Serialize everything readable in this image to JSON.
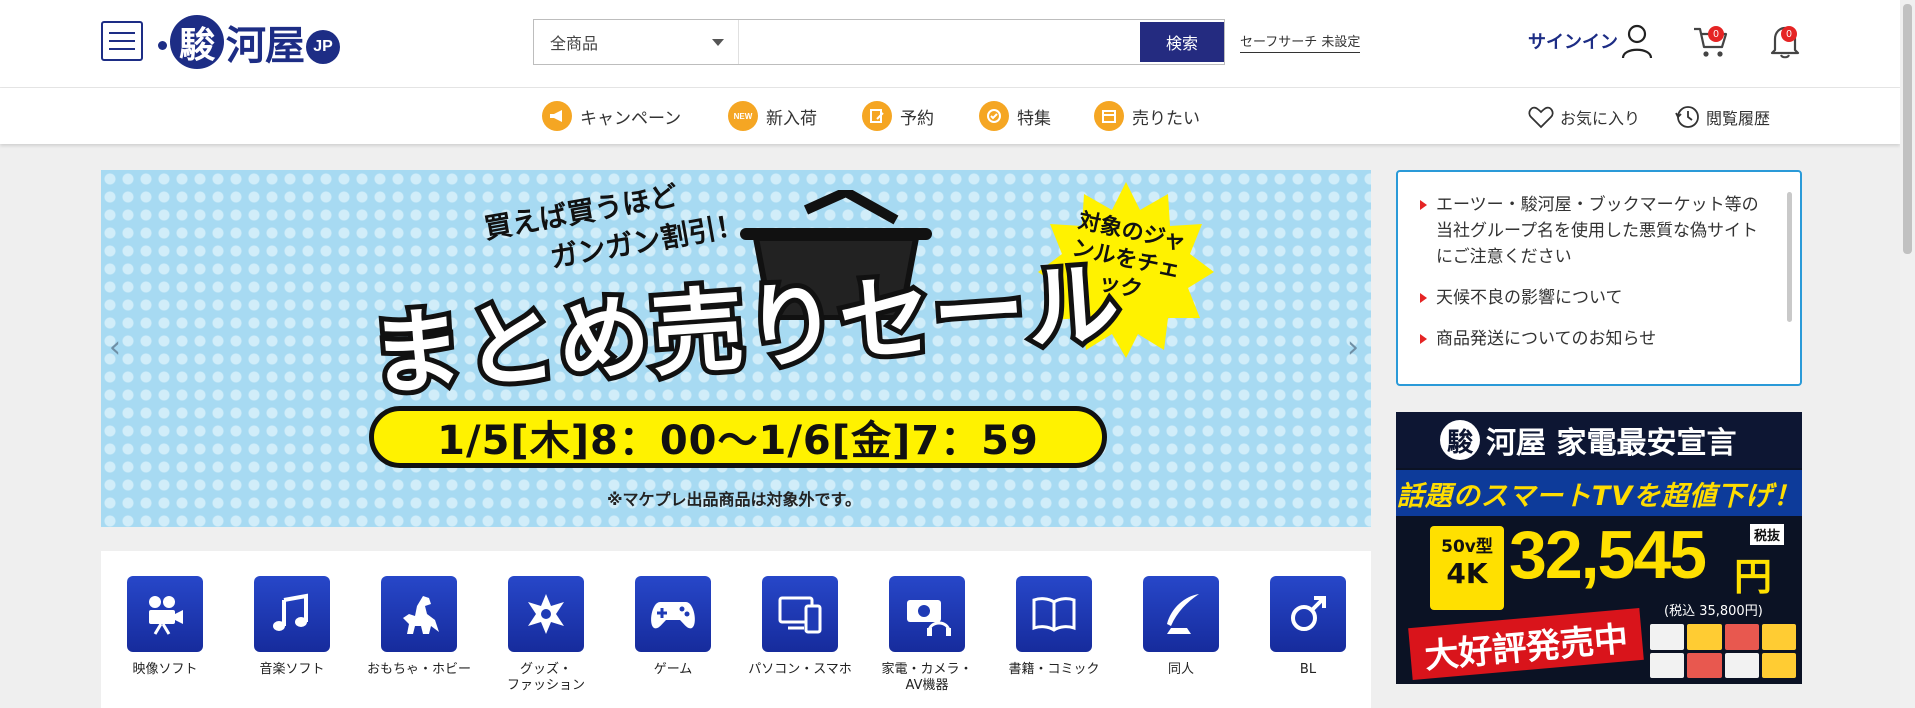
{
  "header": {
    "logo_text": "河屋",
    "logo_mark": "駿",
    "logo_suffix": "JP",
    "search": {
      "category": "全商品",
      "placeholder": "",
      "button": "検索"
    },
    "safesearch": "セーフサーチ 未設定",
    "signin": "サインイン",
    "cart_count": "0",
    "notification_count": "0"
  },
  "nav": {
    "items": [
      {
        "label": "キャンペーン",
        "icon": "megaphone-icon"
      },
      {
        "label": "新入荷",
        "icon": "new-icon",
        "icon_text": "NEW"
      },
      {
        "label": "予約",
        "icon": "reserve-icon"
      },
      {
        "label": "特集",
        "icon": "feature-icon"
      },
      {
        "label": "売りたい",
        "icon": "sell-icon"
      }
    ],
    "favorites": "お気に入り",
    "history": "閲覧履歴"
  },
  "banner": {
    "subtitle_line1": "買えば買うほど",
    "subtitle_line2": "ガンガン割引！",
    "title": "まとめ売りセール",
    "date": "1/5[木]8：00～1/6[金]7：59",
    "star_text": "対象のジャンルをチェック",
    "note": "※マケプレ出品商品は対象外です。",
    "prev": "‹",
    "next": "›"
  },
  "notices": [
    "エーツー・駿河屋・ブックマーケット等の当社グループ名を使用した悪質な偽サイトにご注意ください",
    "天候不良の影響について",
    "商品発送についてのお知らせ"
  ],
  "ad": {
    "brand_mark": "駿",
    "brand": "河屋 家電最安宣言",
    "headline": "話題のスマートTVを超値下げ！",
    "size_small": "50v型",
    "size_big": "4K",
    "price": "32,545",
    "yen": "円",
    "tax_label": "税抜",
    "tax_included": "(税込 35,800円)",
    "banner": "大好評発売中"
  },
  "categories": [
    {
      "label": "映像ソフト",
      "icon": "movie-camera-icon"
    },
    {
      "label": "音楽ソフト",
      "icon": "music-note-icon"
    },
    {
      "label": "おもちゃ・ホビー",
      "icon": "kaiju-icon"
    },
    {
      "label": "グッズ・\nファッション",
      "icon": "badge-star-icon"
    },
    {
      "label": "ゲーム",
      "icon": "gamepad-icon"
    },
    {
      "label": "パソコン・スマホ",
      "icon": "devices-icon"
    },
    {
      "label": "家電・カメラ・\nAV機器",
      "icon": "camera-headphones-icon"
    },
    {
      "label": "書籍・コミック",
      "icon": "open-book-icon"
    },
    {
      "label": "同人",
      "icon": "quill-pen-icon"
    },
    {
      "label": "BL",
      "icon": "male-symbol-icon"
    }
  ],
  "colors": {
    "brand": "#1d2d85",
    "search_button": "#242b80",
    "accent_orange": "#f5a623",
    "notice_border": "#2a9ad8",
    "badge_red": "#e52424"
  }
}
